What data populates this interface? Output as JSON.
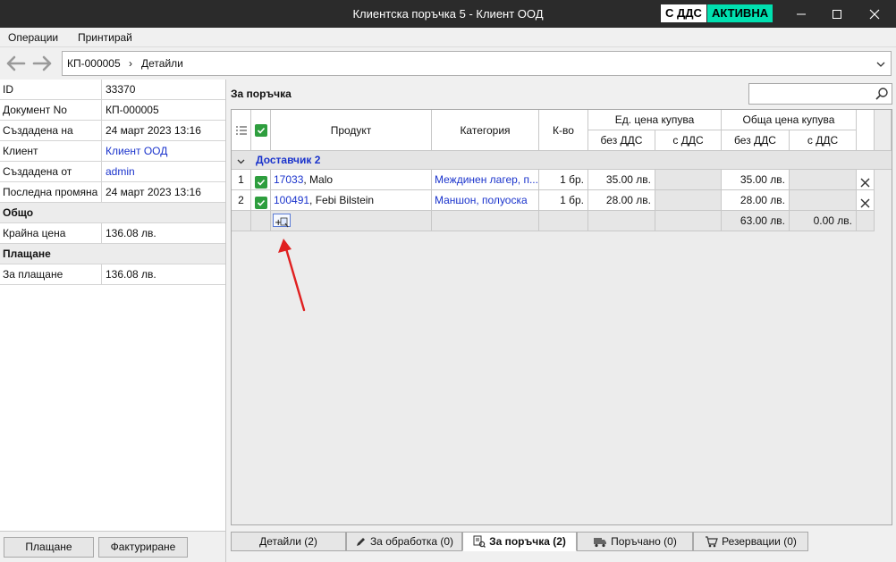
{
  "window": {
    "title": "Клиентска поръчка 5 - Клиент ООД",
    "badge_vat": "С ДДС",
    "badge_status": "АКТИВНА",
    "status_color": "#00e0b0"
  },
  "menu": {
    "items": [
      "Операции",
      "Принтирай"
    ]
  },
  "breadcrumb": {
    "root": "КП-000005",
    "separator": "›",
    "current": "Детайли"
  },
  "properties": {
    "rows": [
      {
        "label": "ID",
        "value": "33370"
      },
      {
        "label": "Документ No",
        "value": "КП-000005"
      },
      {
        "label": "Създадена на",
        "value": "24 март 2023 13:16"
      },
      {
        "label": "Клиент",
        "value": "Клиент ООД"
      },
      {
        "label": "Създадена от",
        "value": "admin"
      },
      {
        "label": "Последна промяна",
        "value": "24 март 2023 13:16"
      }
    ],
    "section_total": "Общо",
    "total_row": {
      "label": "Крайна цена",
      "value": "136.08 лв."
    },
    "section_payment": "Плащане",
    "payment_row": {
      "label": "За плащане",
      "value": "136.08 лв."
    }
  },
  "buttons": {
    "pay": "Плащане",
    "invoice": "Фактуриране"
  },
  "order": {
    "title": "За поръчка",
    "search_placeholder": "",
    "headers": {
      "product": "Продукт",
      "category": "Категория",
      "qty": "К-во",
      "unit_price": "Ед. цена купува",
      "total_price": "Обща цена купува",
      "without_vat": "без ДДС",
      "with_vat": "с ДДС"
    },
    "group": "Доставчик 2",
    "rows": [
      {
        "num": "1",
        "code": "17033",
        "name": ", Malo",
        "category": "Междинен лагер, п...",
        "qty": "1 бр.",
        "unit_no_vat": "35.00 лв.",
        "unit_vat": "",
        "total_no_vat": "35.00 лв.",
        "total_vat": ""
      },
      {
        "num": "2",
        "code": "100491",
        "name": ", Febi Bilstein",
        "category": "Маншон, полуоска",
        "qty": "1 бр.",
        "unit_no_vat": "28.00 лв.",
        "unit_vat": "",
        "total_no_vat": "28.00 лв.",
        "total_vat": ""
      }
    ],
    "totals": {
      "total_no_vat": "63.00 лв.",
      "total_vat": "0.00 лв."
    }
  },
  "tabs": [
    {
      "label": "Детайли (2)",
      "icon": ""
    },
    {
      "label": "За обработка (0)",
      "icon": "pencil-icon"
    },
    {
      "label": "За поръчка (2)",
      "icon": "order-icon"
    },
    {
      "label": "Поръчано (0)",
      "icon": "truck-icon"
    },
    {
      "label": "Резервации (0)",
      "icon": "cart-icon"
    }
  ]
}
